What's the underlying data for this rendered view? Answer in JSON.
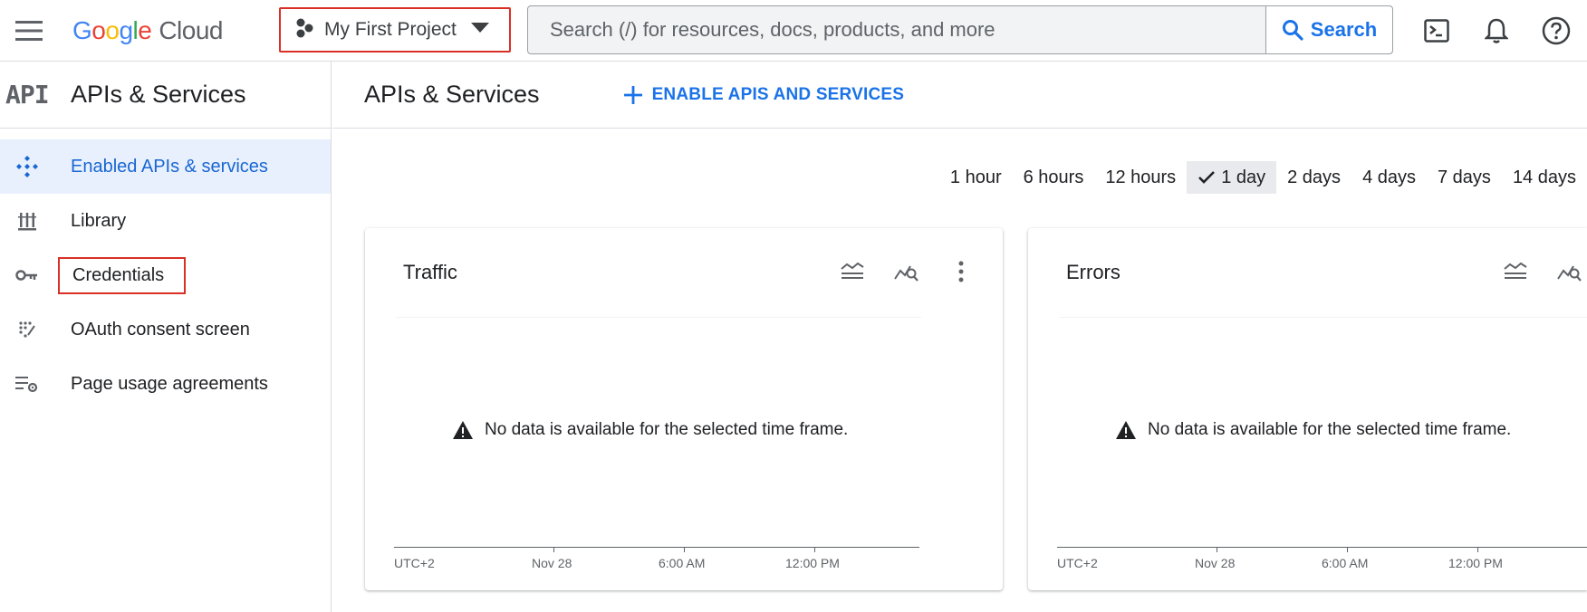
{
  "header": {
    "logo_google": [
      "G",
      "o",
      "o",
      "g",
      "l",
      "e"
    ],
    "logo_cloud": "Cloud",
    "project_label": "My First Project",
    "search_placeholder": "Search (/) for resources, docs, products, and more",
    "search_button": "Search"
  },
  "sidebar": {
    "badge": "API",
    "title": "APIs & Services",
    "items": [
      {
        "label": "Enabled APIs & services",
        "icon": "diamond-dots-icon",
        "active": true
      },
      {
        "label": "Library",
        "icon": "library-icon"
      },
      {
        "label": "Credentials",
        "icon": "key-icon",
        "highlighted": true
      },
      {
        "label": "OAuth consent screen",
        "icon": "oauth-dots-icon"
      },
      {
        "label": "Page usage agreements",
        "icon": "settings-list-icon"
      }
    ]
  },
  "main": {
    "title": "APIs & Services",
    "enable_button": "ENABLE APIS AND SERVICES",
    "time_range": [
      "1 hour",
      "6 hours",
      "12 hours",
      "1 day",
      "2 days",
      "4 days",
      "7 days",
      "14 days"
    ],
    "time_selected": "1 day",
    "cards": [
      {
        "title": "Traffic",
        "message": "No data is available for the selected time frame.",
        "x_ticks": [
          "UTC+2",
          "Nov 28",
          "6:00 AM",
          "12:00 PM"
        ]
      },
      {
        "title": "Errors",
        "message": "No data is available for the selected time frame.",
        "x_ticks": [
          "UTC+2",
          "Nov 28",
          "6:00 AM",
          "12:00 PM"
        ]
      }
    ]
  },
  "colors": {
    "accent_blue": "#1a73e8",
    "highlight_red": "#d93025",
    "active_bg": "#e8f0fe"
  }
}
